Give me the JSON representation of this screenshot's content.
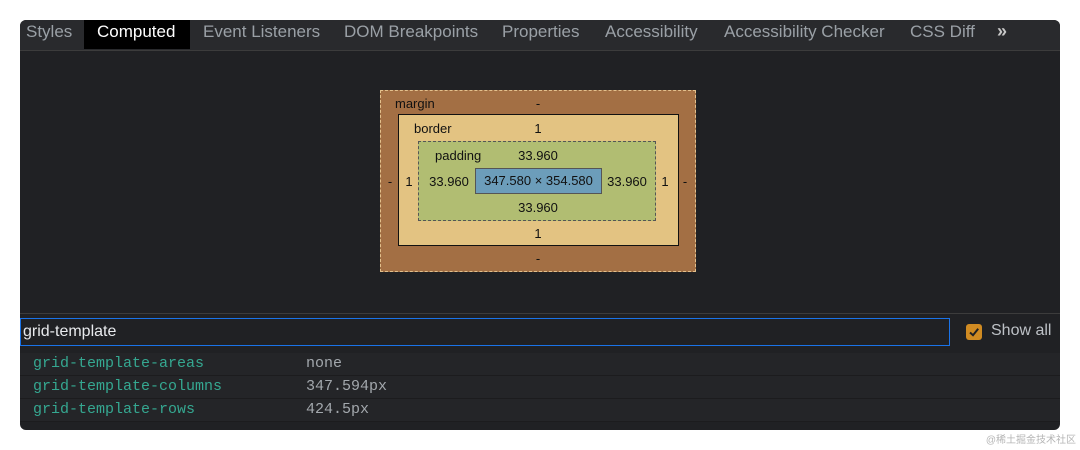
{
  "tabs": [
    {
      "label": "Styles",
      "active": false
    },
    {
      "label": "Computed",
      "active": true
    },
    {
      "label": "Event Listeners",
      "active": false
    },
    {
      "label": "DOM Breakpoints",
      "active": false
    },
    {
      "label": "Properties",
      "active": false
    },
    {
      "label": "Accessibility",
      "active": false
    },
    {
      "label": "Accessibility Checker",
      "active": false
    },
    {
      "label": "CSS Diff",
      "active": false
    }
  ],
  "more_tabs_icon": "»",
  "box_model": {
    "margin": {
      "label": "margin",
      "top": "-",
      "right": "-",
      "bottom": "-",
      "left": "-"
    },
    "border": {
      "label": "border",
      "top": "1",
      "right": "1",
      "bottom": "1",
      "left": "1"
    },
    "padding": {
      "label": "padding",
      "top": "33.960",
      "right": "33.960",
      "bottom": "33.960",
      "left": "33.960"
    },
    "content": "347.580 × 354.580"
  },
  "filter": {
    "value": "grid-template"
  },
  "show_all": {
    "label": "Show all",
    "checked": true
  },
  "properties": [
    {
      "name": "grid-template-areas",
      "value": "none"
    },
    {
      "name": "grid-template-columns",
      "value": "347.594px"
    },
    {
      "name": "grid-template-rows",
      "value": "424.5px"
    }
  ],
  "watermark": "@稀土掘金技术社区",
  "colors": {
    "background": "#202124",
    "margin": "#a36f44",
    "border": "#e3c382",
    "padding": "#b1bd72",
    "content": "#6c9dba",
    "property_name": "#35a891",
    "checkbox": "#d08b22"
  }
}
